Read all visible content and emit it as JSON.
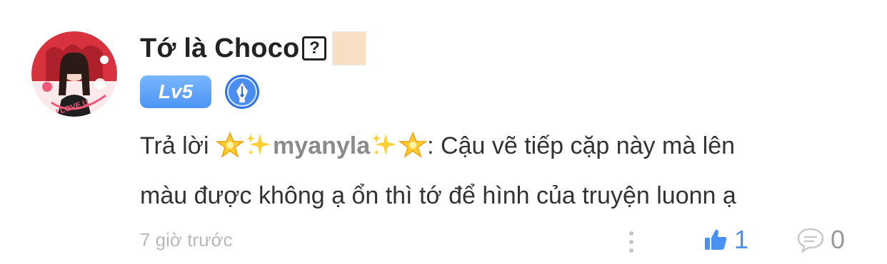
{
  "user": {
    "name": "Tớ là Choco",
    "name_suffix_symbol": "?",
    "avatar_text": "I LOVE U",
    "level": "Lv5",
    "swatch_color": "#f8dec2"
  },
  "comment": {
    "reply_prefix": "Trả lời",
    "mention": "myanyla",
    "body_line1": ": Cậu vẽ tiếp cặp này mà lên",
    "body_line2": "màu được không ạ ổn thì tớ để hình của truyện luonn ạ"
  },
  "meta": {
    "time": "7 giờ trước",
    "likes": "1",
    "replies": "0"
  },
  "icons": [
    "avatar",
    "pen-badge-icon",
    "star-emoji-icon",
    "sparkles-emoji-icon",
    "more-options-icon",
    "thumbs-up-icon",
    "comment-bubble-icon"
  ],
  "colors": {
    "accent": "#4a90f0",
    "level_badge": "#5a9ef7",
    "username": "#222222",
    "text": "#333333",
    "muted": "#b8b8b8"
  }
}
